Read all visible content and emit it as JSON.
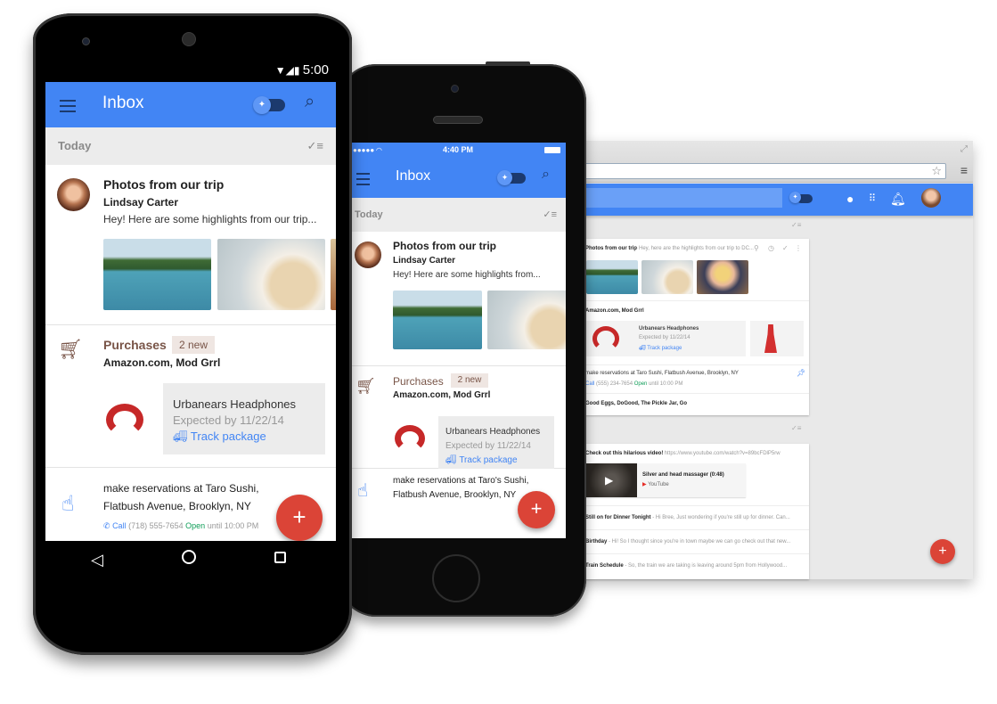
{
  "android": {
    "status_time": "5:00",
    "app_title": "Inbox",
    "section_label": "Today",
    "email": {
      "subject": "Photos from our trip",
      "sender": "Lindsay Carter",
      "snippet": "Hey! Here are some highlights from our trip..."
    },
    "bundle": {
      "title": "Purchases",
      "badge": "2 new",
      "senders": "Amazon.com, Mod Grrl",
      "package_name": "Urbanears Headphones",
      "package_date": "Expected by 11/22/14",
      "track_label": "Track package"
    },
    "reminder": {
      "line1": "make reservations at Taro Sushi,",
      "line2": "Flatbush Avenue, Brooklyn, NY",
      "call_label": "Call",
      "phone": "(718) 555-7654",
      "open_label": "Open",
      "hours": "until 10:00 PM"
    },
    "fab_label": "+"
  },
  "iphone": {
    "status_time": "4:40 PM",
    "app_title": "Inbox",
    "section_label": "Today",
    "email": {
      "subject": "Photos from our trip",
      "sender": "Lindsay Carter",
      "snippet": "Hey! Here are some highlights from..."
    },
    "bundle": {
      "title": "Purchases",
      "badge": "2 new",
      "senders": "Amazon.com, Mod Grrl",
      "package_name": "Urbanears Headphones",
      "package_date": "Expected by 11/22/14",
      "track_label": "Track package"
    },
    "reminder": {
      "line1": "make reservations at Taro's Sushi,",
      "line2": "Flatbush Avenue, Brooklyn, NY"
    },
    "fab_label": "+"
  },
  "browser": {
    "email": {
      "subject": "Photos from our trip",
      "snippet": "– Hey, here are the highlights from our trip to DC..."
    },
    "bundle_senders": "Amazon.com, Mod Grrl",
    "package_name": "Urbanears Headphones",
    "package_date": "Expected by 11/22/14",
    "track_label": "Track package",
    "reminder": {
      "text": "make reservations at Taro Sushi, Flatbush Avenue, Brooklyn, NY",
      "call_label": "Call",
      "phone": "(555) 234-7654",
      "open_label": "Open",
      "hours": "until 10:00 PM"
    },
    "group_senders": "Good Eggs, DoGood, The Pickle Jar, Go",
    "video_email": {
      "subject": "Check out this hilarious video!",
      "link": "- https://www.youtube.com/watch?v=89bcFDlP5rw",
      "video_title": "Silver and head massager (0:48)",
      "video_source": "YouTube"
    },
    "list": [
      {
        "subject": "Still on for Dinner Tonight",
        "snippet": " - Hi Bree, Just wondering if you're still up for dinner. Can..."
      },
      {
        "subject": "Birthday",
        "snippet": " - Hi! So I thought since you're in town maybe we can go check out that new..."
      },
      {
        "subject": "Train Schedule",
        "snippet": " - So, the train we are taking is leaving around 5pm from Hollywood..."
      }
    ],
    "fab_label": "+"
  },
  "colors": {
    "brand_blue": "#4285f4",
    "fab_red": "#db4437",
    "bundle_brown": "#795548",
    "open_green": "#0f9d58"
  }
}
